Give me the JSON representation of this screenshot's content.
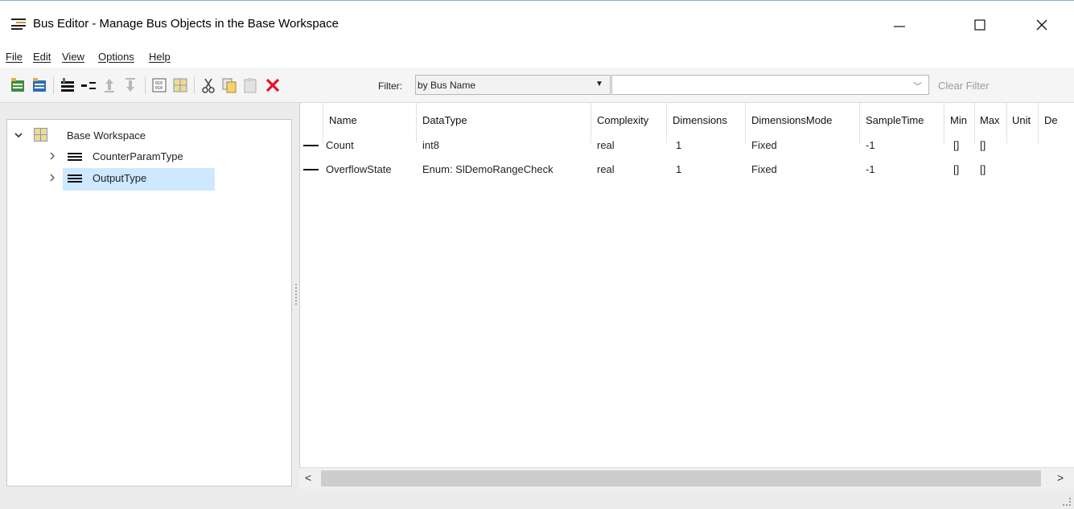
{
  "window": {
    "title": "Bus Editor - Manage Bus Objects in the Base Workspace",
    "icon": "bus-editor-icon",
    "controls": [
      "minimize-icon",
      "maximize-icon",
      "close-icon"
    ]
  },
  "menu": {
    "items": [
      "File",
      "Edit",
      "View",
      "Options",
      "Help"
    ]
  },
  "toolbar": {
    "icons": [
      "new-bus-icon",
      "new-bus-from-element-icon",
      "add-element-icon",
      "insert-element-icon",
      "move-up-icon",
      "move-down-icon",
      "create-signal-icon",
      "workspace-grid-icon",
      "cut-icon",
      "copy-icon",
      "paste-icon",
      "delete-icon"
    ],
    "filter_label": "Filter:",
    "filter_mode": "by Bus Name",
    "filter_text": "",
    "clear_filter": "Clear Filter"
  },
  "tree": {
    "root": "Base Workspace",
    "children": [
      "CounterParamType",
      "OutputType"
    ],
    "selected": "OutputType"
  },
  "table": {
    "columns": [
      "Name",
      "DataType",
      "Complexity",
      "Dimensions",
      "DimensionsMode",
      "SampleTime",
      "Min",
      "Max",
      "Unit",
      "De"
    ],
    "rows": [
      [
        "Count",
        "int8",
        "real",
        "1",
        "Fixed",
        "-1",
        "[]",
        "[]",
        "",
        ""
      ],
      [
        "OverflowState",
        "Enum: SlDemoRangeCheck",
        "real",
        "1",
        "Fixed",
        "-1",
        "[]",
        "[]",
        "",
        ""
      ]
    ]
  },
  "scrollbar": {
    "left_arrow": "<",
    "right_arrow": ">"
  },
  "colors": {
    "selection": "#cde8ff",
    "delete_icon": "#e81123",
    "disabled_text": "#9b9b9b"
  }
}
